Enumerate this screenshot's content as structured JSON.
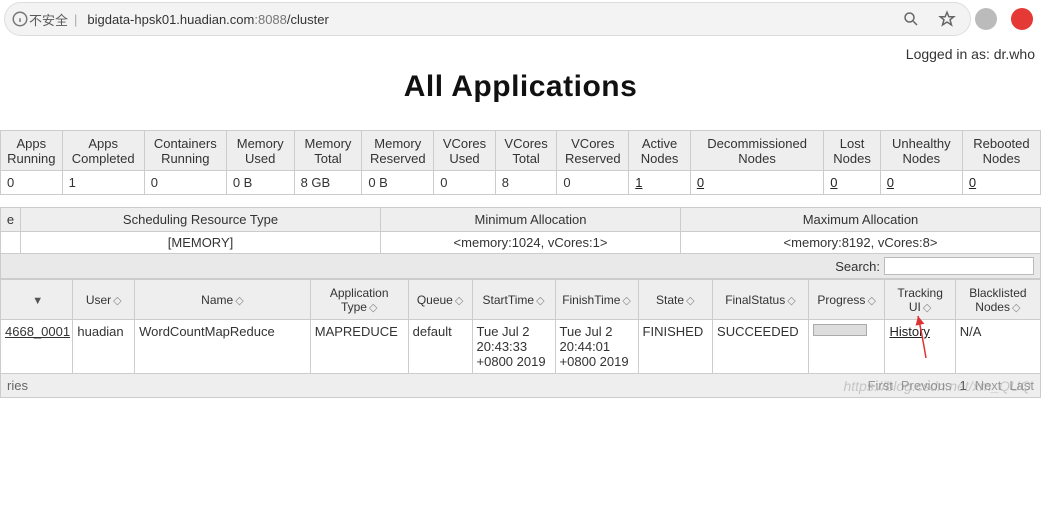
{
  "browser": {
    "not_secure": "不安全",
    "host": "bigdata-hpsk01.huadian.com",
    "port": ":8088",
    "path": "/cluster"
  },
  "header": {
    "logged_in": "Logged in as: dr.who",
    "title": "All Applications"
  },
  "metrics": {
    "headers": [
      "Apps Running",
      "Apps Completed",
      "Containers Running",
      "Memory Used",
      "Memory Total",
      "Memory Reserved",
      "VCores Used",
      "VCores Total",
      "VCores Reserved",
      "Active Nodes",
      "Decommissioned Nodes",
      "Lost Nodes",
      "Unhealthy Nodes",
      "Rebooted Nodes"
    ],
    "values": [
      "0",
      "1",
      "0",
      "0 B",
      "8 GB",
      "0 B",
      "0",
      "8",
      "0",
      "1",
      "0",
      "0",
      "0",
      "0"
    ]
  },
  "sched": {
    "headers": [
      "e",
      "Scheduling Resource Type",
      "Minimum Allocation",
      "Maximum Allocation"
    ],
    "values": [
      "",
      "[MEMORY]",
      "<memory:1024, vCores:1>",
      "<memory:8192, vCores:8>"
    ]
  },
  "search": {
    "label": "Search:",
    "value": ""
  },
  "apps": {
    "headers": [
      "",
      "User",
      "Name",
      "Application Type",
      "Queue",
      "StartTime",
      "FinishTime",
      "State",
      "FinalStatus",
      "Progress",
      "Tracking UI",
      "Blacklisted Nodes"
    ],
    "row": {
      "id": "4668_0001",
      "user": "huadian",
      "name": "WordCountMapReduce",
      "apptype": "MAPREDUCE",
      "queue": "default",
      "start": "Tue Jul 2 20:43:33 +0800 2019",
      "finish": "Tue Jul 2 20:44:01 +0800 2019",
      "state": "FINISHED",
      "final": "SUCCEEDED",
      "tracking": "History",
      "blacklist": "N/A"
    }
  },
  "paging": {
    "entries": "ries",
    "first": "First",
    "prev": "Previous",
    "page": "1",
    "next": "Next",
    "last": "Last"
  },
  "watermark": "https://blog.csdn.net/xm_QUQ"
}
